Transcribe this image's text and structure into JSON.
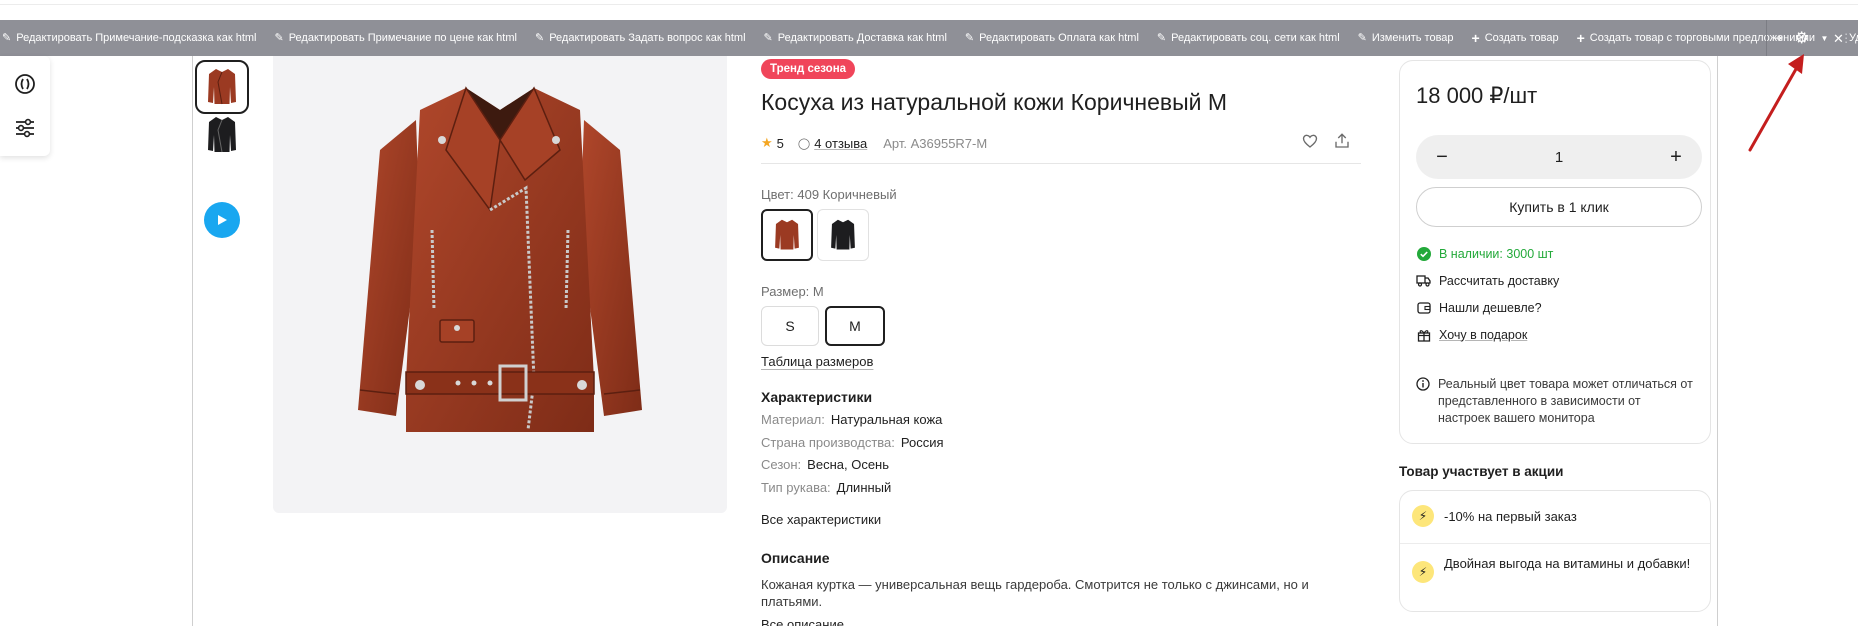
{
  "admin_bar": {
    "items": [
      {
        "icon": "pencil-icon",
        "label": "Редактировать Примечание-подсказка как html"
      },
      {
        "icon": "pencil-icon",
        "label": "Редактировать Примечание по цене как html"
      },
      {
        "icon": "pencil-icon",
        "label": "Редактировать Задать вопрос как html"
      },
      {
        "icon": "pencil-icon",
        "label": "Редактировать Доставка как html"
      },
      {
        "icon": "pencil-icon",
        "label": "Редактировать Оплата как html"
      },
      {
        "icon": "pencil-icon",
        "label": "Редактировать соц. сети как html"
      },
      {
        "icon": "pencil-icon",
        "label": "Изменить товар"
      },
      {
        "icon": "plus-icon",
        "label": "Создать товар"
      },
      {
        "icon": "plus-icon",
        "label": "Создать товар с торговыми предложениями"
      },
      {
        "icon": "close-icon",
        "label": "Удалить товар"
      }
    ],
    "colors": {
      "background": "#8f9097",
      "text": "#ffffff"
    }
  },
  "product": {
    "badge": "Тренд сезона",
    "title": "Косуха из натуральной кожи Коричневый M",
    "rating": "5",
    "reviews": "4 отзыва",
    "sku": "Арт. A36955R7-M",
    "color_label": "Цвет: 409 Коричневый",
    "color_options": [
      "brown",
      "black"
    ],
    "size_label": "Размер: M",
    "sizes": [
      "S",
      "M"
    ],
    "selected_size": "M",
    "size_table_link": "Таблица размеров",
    "characteristics_title": "Характеристики",
    "characteristics": [
      {
        "key": "Материал:",
        "value": "Натуральная кожа"
      },
      {
        "key": "Страна производства:",
        "value": "Россия"
      },
      {
        "key": "Сезон:",
        "value": "Весна, Осень"
      },
      {
        "key": "Тип рукава:",
        "value": "Длинный"
      }
    ],
    "all_characteristics_link": "Все характеристики",
    "description_title": "Описание",
    "description": "Кожаная куртка — универсальная вещь гардероба. Смотрится не только с джинсами, но и платьями.",
    "all_description_link": "Все описание",
    "colors": {
      "badge": "#f0455a",
      "star": "#f4a622",
      "jacket_brown": "#9b3a22",
      "play": "#19a7f0"
    }
  },
  "buy_box": {
    "price": "18 000 ₽/шт",
    "quantity": "1",
    "buy_one_click": "Купить в 1 клик",
    "stock": "В наличии: 3000 шт",
    "delivery": "Рассчитать доставку",
    "cheaper": "Нашли дешевле?",
    "gift": "Хочу в подарок",
    "note": "Реальный цвет товара может отличаться от представленного в зависимости от настроек вашего монитора",
    "stock_color": "#23a93a"
  },
  "promo": {
    "title": "Товар участвует в акции",
    "items": [
      "-10% на первый заказ",
      "Двойная выгода на витамины и добавки!"
    ]
  }
}
